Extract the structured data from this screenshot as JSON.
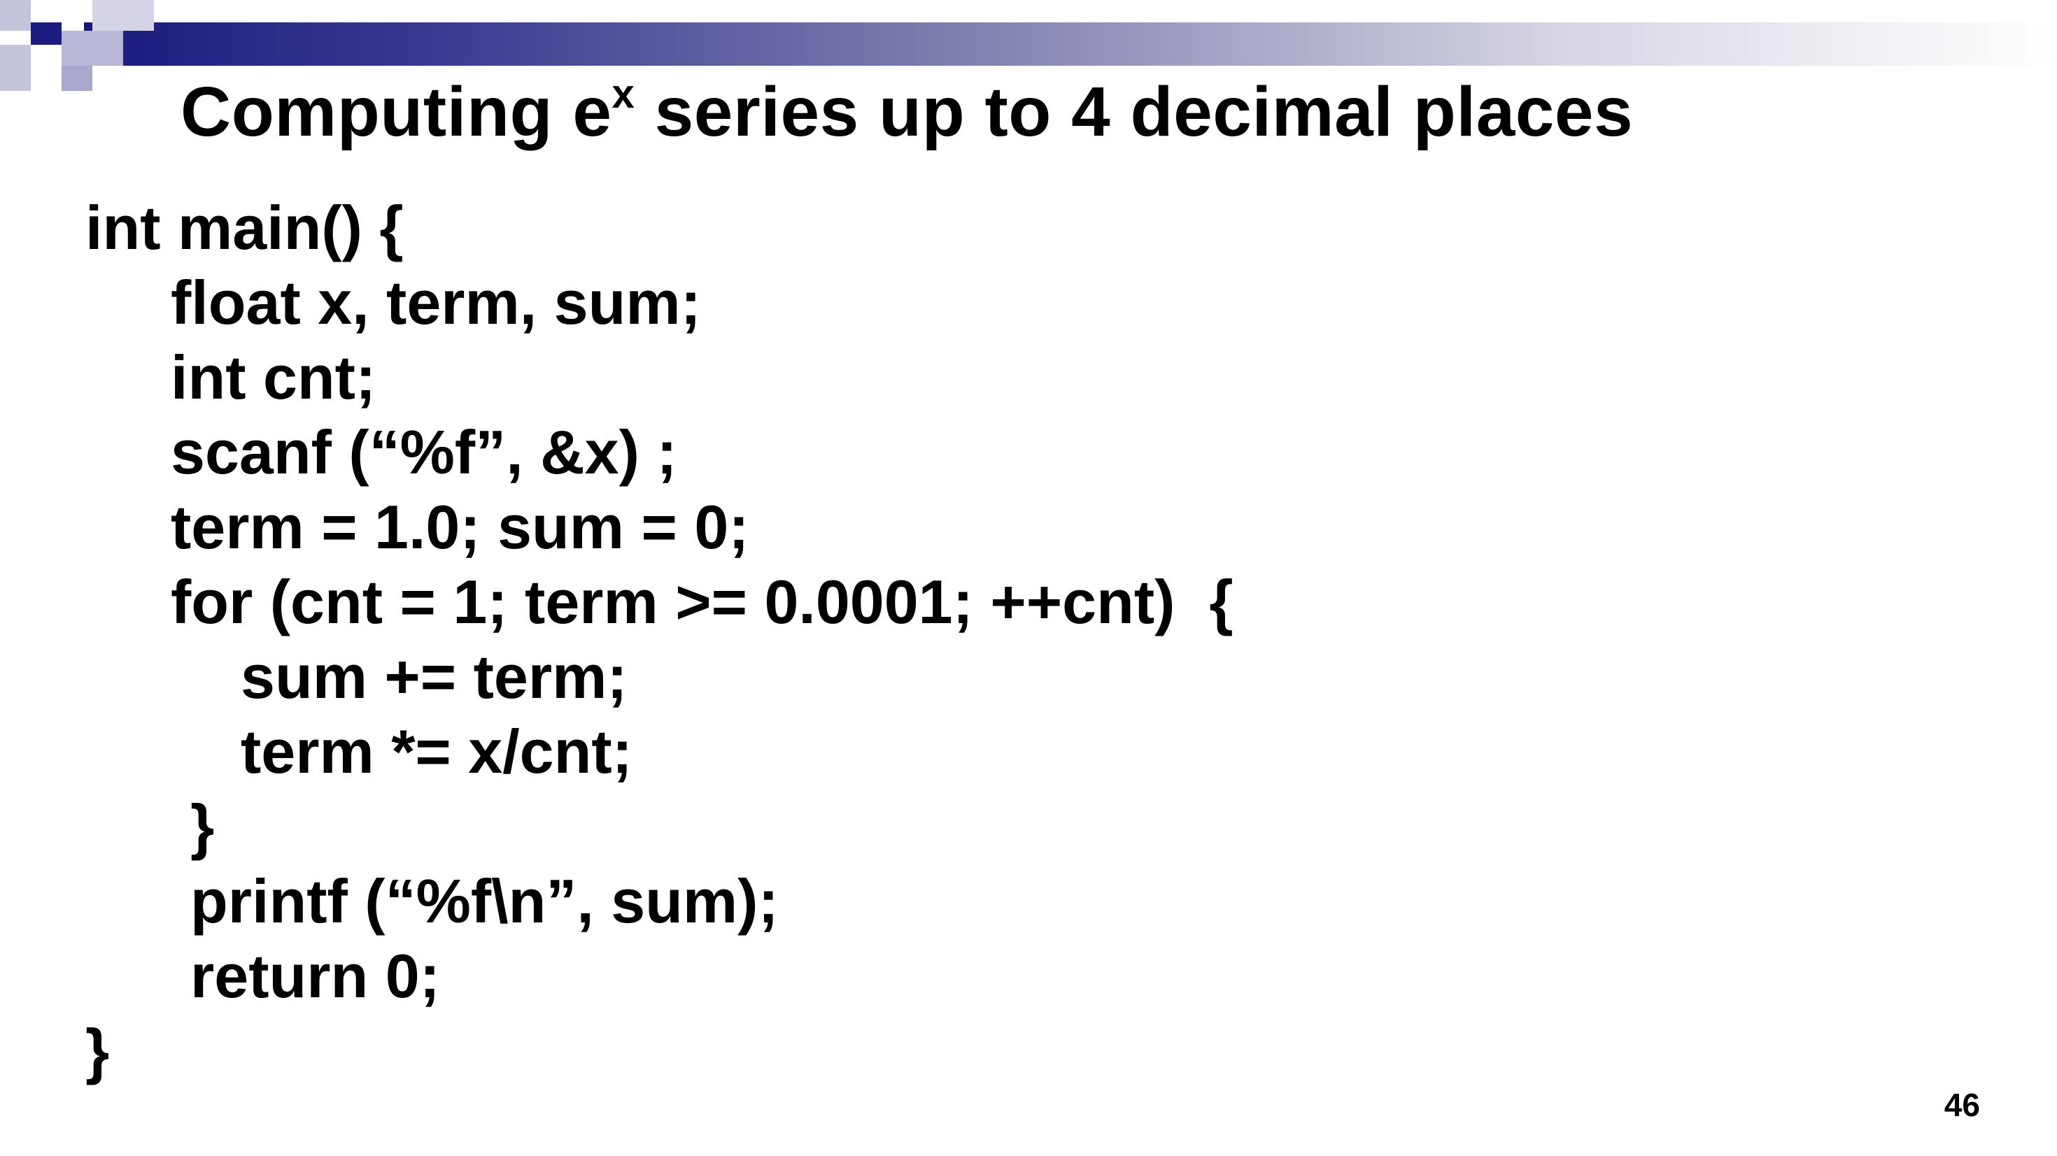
{
  "slide": {
    "title_prefix": "Computing e",
    "title_superscript": "x",
    "title_suffix": " series up to 4 decimal places",
    "page_number": "46"
  },
  "code": {
    "lines": [
      "int main() {",
      "float x, term, sum;",
      "int cnt;",
      "scanf (“%f”, &x) ;",
      "term = 1.0; sum = 0;",
      "for (cnt = 1; term >= 0.0001; ++cnt)  {",
      "sum += term;",
      "term *= x/cnt;",
      "}",
      "printf (“%f\\n”, sum);",
      "return 0;",
      "}"
    ]
  },
  "colors": {
    "accent_dark": "#1c1c80",
    "accent_light": "#c4c4dc",
    "text": "#000000",
    "background": "#ffffff"
  }
}
